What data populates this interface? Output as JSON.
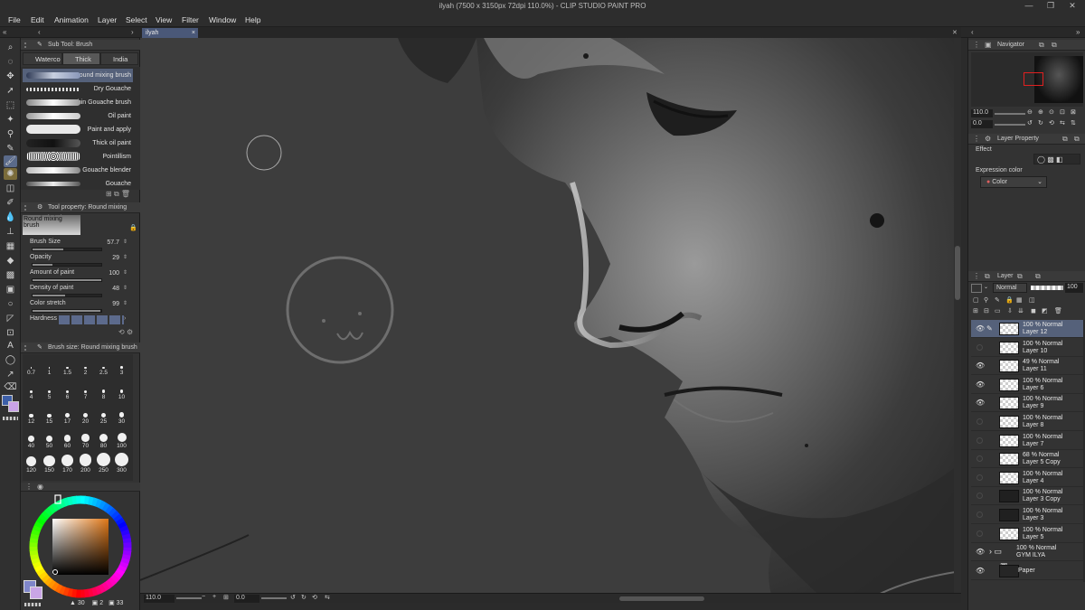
{
  "window": {
    "title": "ilyah (7500 x 3150px 72dpi 110.0%)  - CLIP STUDIO PAINT PRO"
  },
  "menu": [
    "File",
    "Edit",
    "Animation",
    "Layer",
    "Select",
    "View",
    "Filter",
    "Window",
    "Help"
  ],
  "document_tab": {
    "label": "ilyah"
  },
  "subtool_panel": {
    "title": "Sub Tool: Brush",
    "tabs": [
      "Waterco",
      "Thick",
      "India ink"
    ],
    "brushes": [
      "Round mixing brush",
      "Dry Gouache",
      "Thin Gouache brush",
      "Oil paint",
      "Paint and apply",
      "Thick oil paint",
      "Pointillism",
      "Gouache blender",
      "Gouache"
    ]
  },
  "tool_property": {
    "title": "Tool property: Round mixing brush",
    "preset_name": "Round mixing brush",
    "properties": [
      {
        "label": "Brush Size",
        "value": "57.7",
        "level": 0.45
      },
      {
        "label": "Opacity",
        "value": "29",
        "level": 0.29
      },
      {
        "label": "Amount of paint",
        "value": "100",
        "level": 1.0
      },
      {
        "label": "Density of paint",
        "value": "48",
        "level": 0.48
      },
      {
        "label": "Color stretch",
        "value": "99",
        "level": 0.99
      }
    ],
    "hardness_label": "Hardness"
  },
  "brush_size_panel": {
    "title": "Brush size: Round mixing brush",
    "sizes": [
      "0.7",
      "1",
      "1.5",
      "2",
      "2.5",
      "3",
      "4",
      "5",
      "6",
      "7",
      "8",
      "10",
      "12",
      "15",
      "17",
      "20",
      "25",
      "30",
      "40",
      "50",
      "60",
      "70",
      "80",
      "100",
      "120",
      "150",
      "170",
      "200",
      "250",
      "300"
    ]
  },
  "color_wheel": {
    "values": [
      "30",
      "2",
      "33"
    ],
    "main_color": "#8a8fd8"
  },
  "status": {
    "zoom": "110.0",
    "rotation": "0.0"
  },
  "navigator": {
    "title": "Navigator",
    "zoom": "110.0",
    "rotation": "0.0"
  },
  "layer_property": {
    "title": "Layer Property",
    "effect_label": "Effect",
    "expression_label": "Expression color",
    "expression_value": "Color"
  },
  "layer_panel": {
    "title": "Layer",
    "blend_mode": "Normal",
    "opacity": "100",
    "layers": [
      {
        "line1": "100 % Normal",
        "line2": "Layer 12",
        "visible": true,
        "selected": true,
        "thumb": "checker"
      },
      {
        "line1": "100 % Normal",
        "line2": "Layer 10",
        "visible": false,
        "selected": false,
        "thumb": "checker"
      },
      {
        "line1": "49 % Normal",
        "line2": "Layer 11",
        "visible": true,
        "selected": false,
        "thumb": "checker"
      },
      {
        "line1": "100 % Normal",
        "line2": "Layer 6",
        "visible": true,
        "selected": false,
        "thumb": "checker"
      },
      {
        "line1": "100 % Normal",
        "line2": "Layer 9",
        "visible": true,
        "selected": false,
        "thumb": "checker"
      },
      {
        "line1": "100 % Normal",
        "line2": "Layer 8",
        "visible": false,
        "selected": false,
        "thumb": "checker"
      },
      {
        "line1": "100 % Normal",
        "line2": "Layer 7",
        "visible": false,
        "selected": false,
        "thumb": "checker"
      },
      {
        "line1": "68 % Normal",
        "line2": "Layer 5 Copy",
        "visible": false,
        "selected": false,
        "thumb": "checker"
      },
      {
        "line1": "100 % Normal",
        "line2": "Layer 4",
        "visible": false,
        "selected": false,
        "thumb": "checker"
      },
      {
        "line1": "100 % Normal",
        "line2": "Layer 3 Copy",
        "visible": false,
        "selected": false,
        "thumb": "dark"
      },
      {
        "line1": "100 % Normal",
        "line2": "Layer 3",
        "visible": false,
        "selected": false,
        "thumb": "dark"
      },
      {
        "line1": "100 % Normal",
        "line2": "Layer 5",
        "visible": false,
        "selected": false,
        "thumb": "checker"
      },
      {
        "line1": "100 % Normal",
        "line2": "GYM ILYA",
        "visible": true,
        "selected": false,
        "thumb": "folder"
      },
      {
        "line1": "",
        "line2": "Paper",
        "visible": true,
        "selected": false,
        "thumb": "paper"
      }
    ]
  }
}
